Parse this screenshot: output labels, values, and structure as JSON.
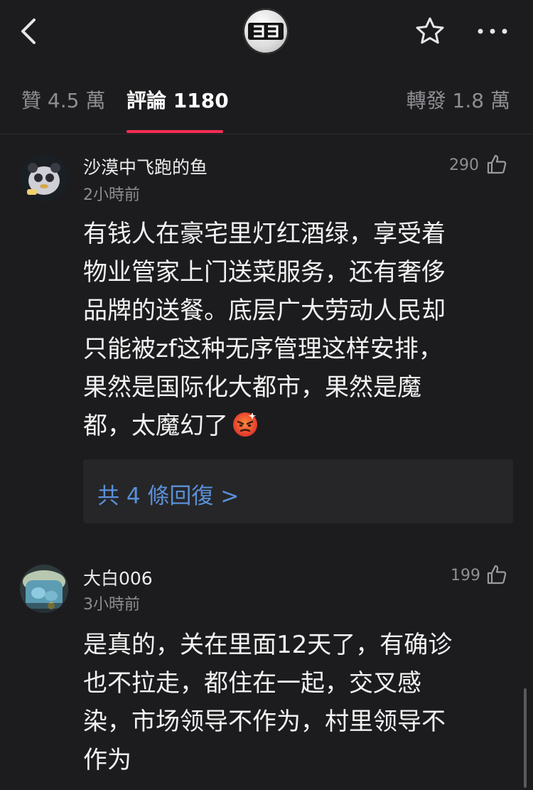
{
  "header": {
    "back_icon": "chevron-left-icon",
    "logo_text": "ヨヨ",
    "star_icon": "star-outline-icon",
    "more_icon": "ellipsis-icon"
  },
  "tabs": [
    {
      "label": "贊 4.5 萬",
      "active": false
    },
    {
      "label": "評論 1180",
      "active": true
    },
    {
      "label": "轉發 1.8 萬",
      "active": false
    }
  ],
  "accent_color": "#ff2d55",
  "link_color": "#5a90d8",
  "comments": [
    {
      "author": "沙漠中飞跑的鱼",
      "time": "2小時前",
      "likes": "290",
      "text": "有钱人在豪宅里灯红酒绿，享受着\n物业管家上门送菜服务，还有奢侈\n品牌的送餐。底层广大劳动人民却\n只能被zf这种无序管理这样安排，\n果然是国际化大都市，果然是魔\n都，太魔幻了",
      "emoji": "angry-face-icon",
      "replies_label": "共 4 條回復 >"
    },
    {
      "author": "大白006",
      "time": "3小時前",
      "likes": "199",
      "text": "是真的，关在里面12天了，有确诊\n也不拉走，都住在一起，交叉感\n染，市场领导不作为，村里领导不\n作为"
    }
  ]
}
